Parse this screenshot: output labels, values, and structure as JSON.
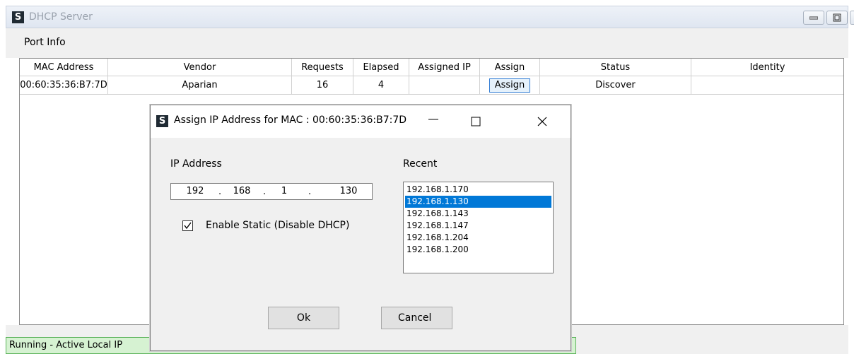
{
  "window": {
    "title": "DHCP Server",
    "icon": "S"
  },
  "menu": {
    "port_info": "Port Info"
  },
  "grid": {
    "headers": [
      "MAC Address",
      "Vendor",
      "Requests",
      "Elapsed",
      "Assigned IP",
      "Assign",
      "Status",
      "Identity"
    ],
    "rows": [
      {
        "mac": "00:60:35:36:B7:7D",
        "vendor": "Aparian",
        "requests": "16",
        "elapsed": "4",
        "assigned_ip": "",
        "assign_label": "Assign",
        "status": "Discover",
        "identity": ""
      }
    ]
  },
  "statusbar": {
    "text": "Running - Active Local IP"
  },
  "dialog": {
    "icon": "S",
    "title": "Assign IP Address for MAC : 00:60:35:36:B7:7D",
    "ip_label": "IP Address",
    "ip_parts": [
      "192",
      "168",
      "1",
      "130"
    ],
    "enable_static_label": "Enable Static (Disable DHCP)",
    "enable_static_checked": true,
    "recent_label": "Recent",
    "recent": [
      "192.168.1.170",
      "192.168.1.130",
      "192.168.1.143",
      "192.168.1.147",
      "192.168.1.204",
      "192.168.1.200"
    ],
    "recent_selected_index": 1,
    "ok_label": "Ok",
    "cancel_label": "Cancel"
  },
  "colors": {
    "selection": "#0078d7",
    "status_bg": "#d6f2d2"
  }
}
